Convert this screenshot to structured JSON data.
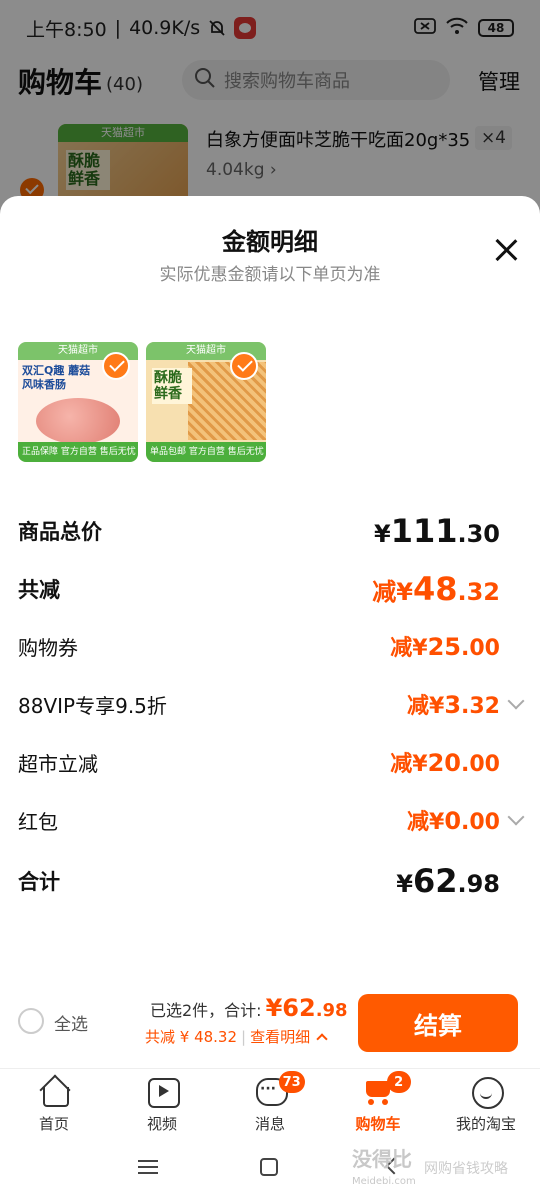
{
  "status_bar": {
    "time": "上午8:50",
    "network_speed": "40.9K/s",
    "battery": "48"
  },
  "cart_header": {
    "title": "购物车",
    "count": "(40)",
    "search_placeholder": "搜索购物车商品",
    "manage_label": "管理"
  },
  "background_item": {
    "name": "白象方便面咔芝脆干吃面20g*35",
    "weight": "4.04kg",
    "quantity": "×4",
    "thumb_tag": "天猫超市",
    "thumb_word": "酥脆鲜香"
  },
  "sheet": {
    "title": "金额明细",
    "subtitle": "实际优惠金额请以下单页为准",
    "thumbs": [
      {
        "banner": "天猫超市",
        "label": "双汇Q趣 蘑菇风味香肠",
        "footer": "正品保障 官方自营 售后无忧"
      },
      {
        "banner": "天猫超市",
        "label": "酥脆鲜香",
        "footer": "单品包邮 官方自营 售后无忧"
      }
    ],
    "rows": [
      {
        "label": "商品总价",
        "prefix": "¥",
        "integer": "111",
        "decimal": ".30"
      },
      {
        "label": "共减",
        "prefix": "减¥",
        "integer": "48",
        "decimal": ".32"
      },
      {
        "label": "购物券",
        "prefix": "减¥",
        "integer": "25",
        "decimal": ".00"
      },
      {
        "label": "88VIP专享9.5折",
        "prefix": "减¥",
        "integer": "3",
        "decimal": ".32"
      },
      {
        "label": "超市立减",
        "prefix": "减¥",
        "integer": "20",
        "decimal": ".00"
      },
      {
        "label": "红包",
        "prefix": "减¥",
        "integer": "0",
        "decimal": ".00"
      },
      {
        "label": "合计",
        "prefix": "¥",
        "integer": "62",
        "decimal": ".98"
      }
    ]
  },
  "checkout": {
    "select_all": "全选",
    "selected_text": "已选2件，合计:",
    "total_integer": "¥62",
    "total_decimal": ".98",
    "discount_text": "共减 ¥ 48.32",
    "separator": "|",
    "detail_link": "查看明细",
    "button": "结算"
  },
  "tabbar": [
    {
      "label": "首页"
    },
    {
      "label": "视频"
    },
    {
      "label": "消息",
      "badge": "73"
    },
    {
      "label": "购物车",
      "badge": "2"
    },
    {
      "label": "我的淘宝"
    }
  ],
  "watermark": {
    "main": "没得比",
    "sub": "Meidebi.com",
    "right": "网购省钱攻略"
  },
  "colors": {
    "accent": "#ff5000",
    "button": "#ff5a00"
  }
}
